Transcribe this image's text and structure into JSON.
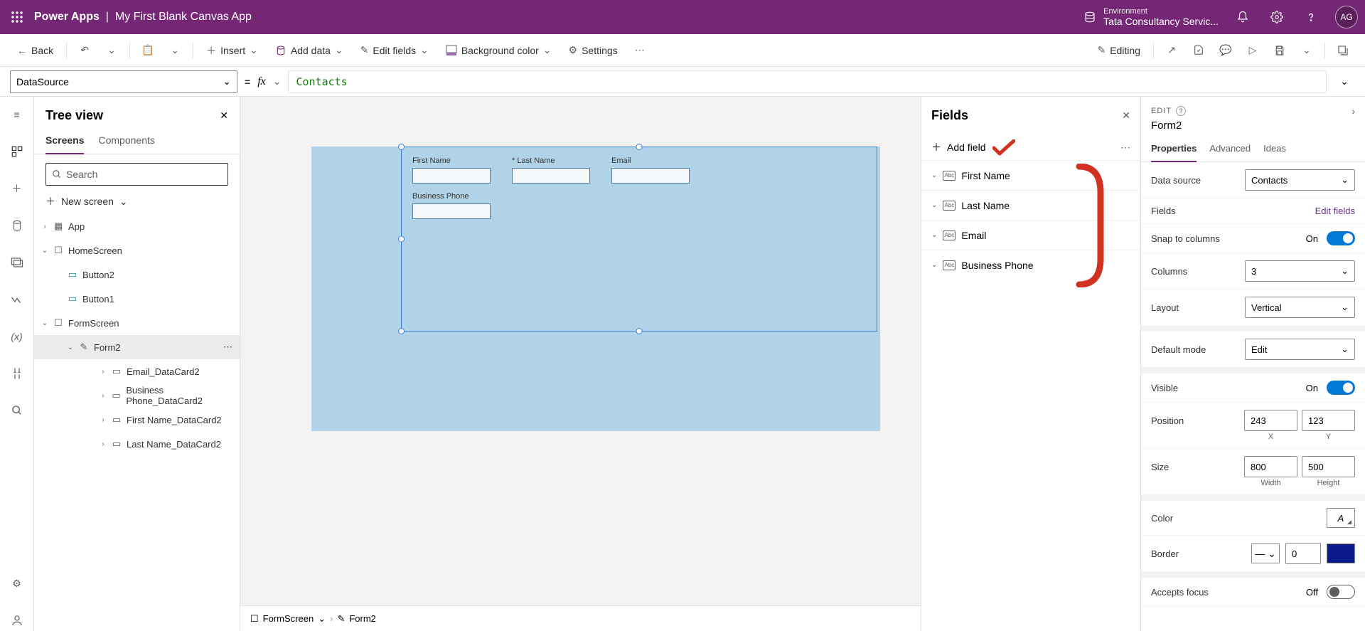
{
  "header": {
    "product": "Power Apps",
    "sep": "|",
    "app_name": "My First Blank Canvas App",
    "env_label": "Environment",
    "env_name": "Tata Consultancy Servic...",
    "avatar": "AG"
  },
  "cmdbar": {
    "back": "Back",
    "insert": "Insert",
    "add_data": "Add data",
    "edit_fields": "Edit fields",
    "bgcolor": "Background color",
    "settings": "Settings",
    "editing": "Editing"
  },
  "fbar": {
    "property": "DataSource",
    "fx": "fx",
    "formula": "Contacts"
  },
  "tree": {
    "title": "Tree view",
    "tabs": {
      "screens": "Screens",
      "components": "Components"
    },
    "search": "Search",
    "new_screen": "New screen",
    "items": {
      "app": "App",
      "home": "HomeScreen",
      "btn2": "Button2",
      "btn1": "Button1",
      "formscreen": "FormScreen",
      "form2": "Form2",
      "dc_email": "Email_DataCard2",
      "dc_phone": "Business Phone_DataCard2",
      "dc_first": "First Name_DataCard2",
      "dc_last": "Last Name_DataCard2"
    }
  },
  "canvas": {
    "cards": {
      "first": "First Name",
      "last": "Last Name",
      "email": "Email",
      "phone": "Business Phone"
    },
    "bc_screen": "FormScreen",
    "bc_form": "Form2"
  },
  "fields": {
    "title": "Fields",
    "add": "Add field",
    "type": "Abc",
    "f1": "First Name",
    "f2": "Last Name",
    "f3": "Email",
    "f4": "Business Phone"
  },
  "props": {
    "edit": "EDIT",
    "name": "Form2",
    "tabs": {
      "properties": "Properties",
      "advanced": "Advanced",
      "ideas": "Ideas"
    },
    "datasource": {
      "label": "Data source",
      "value": "Contacts"
    },
    "fields": {
      "label": "Fields",
      "link": "Edit fields"
    },
    "snap": {
      "label": "Snap to columns",
      "value": "On"
    },
    "columns": {
      "label": "Columns",
      "value": "3"
    },
    "layout": {
      "label": "Layout",
      "value": "Vertical"
    },
    "defaultmode": {
      "label": "Default mode",
      "value": "Edit"
    },
    "visible": {
      "label": "Visible",
      "value": "On"
    },
    "position": {
      "label": "Position",
      "x": "243",
      "y": "123",
      "xl": "X",
      "yl": "Y"
    },
    "size": {
      "label": "Size",
      "w": "800",
      "h": "500",
      "wl": "Width",
      "hl": "Height"
    },
    "color": {
      "label": "Color"
    },
    "border": {
      "label": "Border",
      "value": "0"
    },
    "accepts": {
      "label": "Accepts focus",
      "value": "Off"
    }
  }
}
